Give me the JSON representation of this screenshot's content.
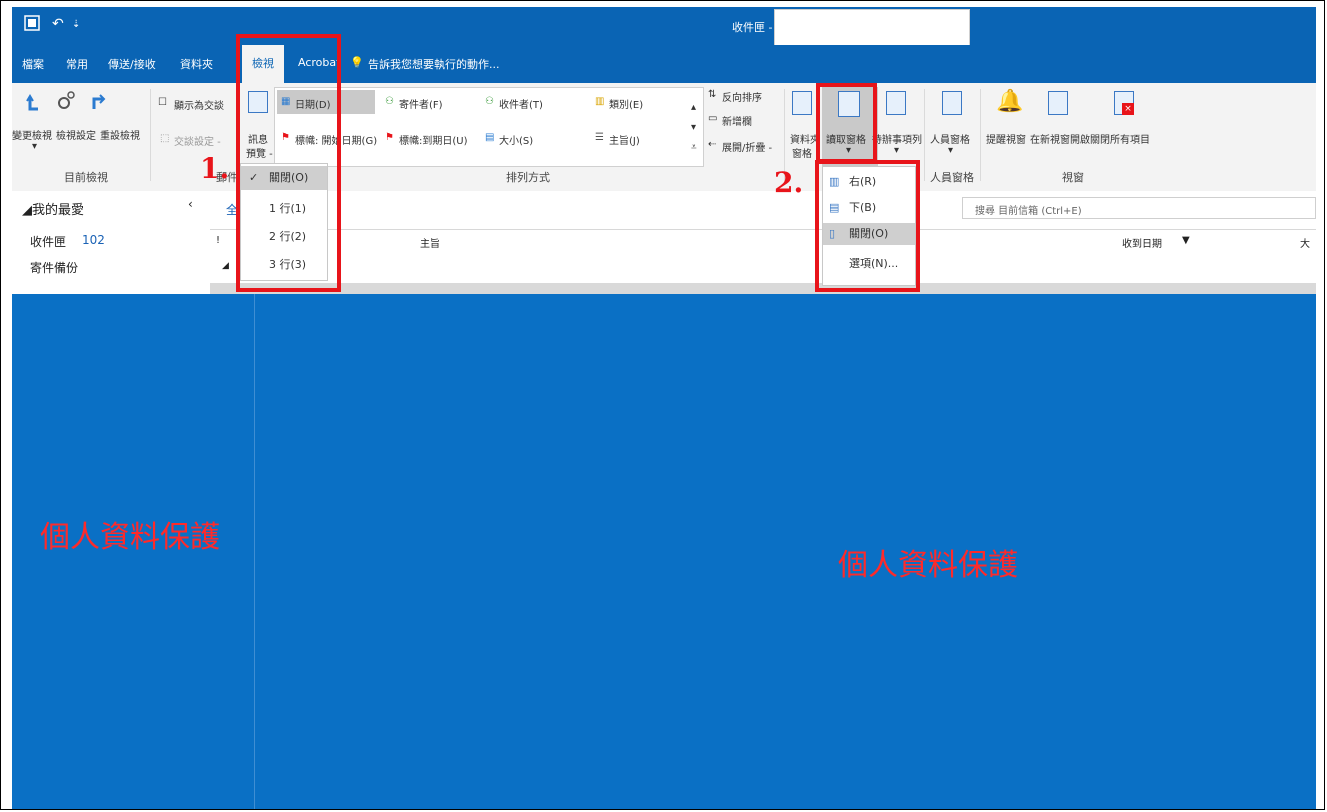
{
  "titlebar": {
    "title": "收件匣 -",
    "quick_undo": "↶",
    "quick_more": "⇣"
  },
  "tabs": [
    {
      "label": "檔案"
    },
    {
      "label": "常用"
    },
    {
      "label": "傳送/接收"
    },
    {
      "label": "資料夾"
    },
    {
      "label": "檢視",
      "active": true
    },
    {
      "label": "Acrobat"
    },
    {
      "label": "告訴我您想要執行的動作..."
    }
  ],
  "ribbon": {
    "current_view": {
      "change_view": "變更檢視",
      "view_settings": "檢視設定",
      "reset_view": "重設檢視",
      "group": "目前檢視"
    },
    "messages": {
      "show_conversations": "顯示為交談",
      "conversation_settings": "交談設定 -",
      "group": "郵件"
    },
    "preview": {
      "label_line1": "訊息",
      "label_line2": "預覽 -"
    },
    "arrangement": {
      "date": "日期(D)",
      "from": "寄件者(F)",
      "to": "收件者(T)",
      "categories": "類別(E)",
      "flag_start": "標幟: 開始日期(G)",
      "flag_due": "標幟:到期日(U)",
      "size": "大小(S)",
      "subject": "主旨(J)",
      "reverse_sort": "反向排序",
      "add_columns": "新增欄",
      "expand_collapse": "展開/折疊 -",
      "group": "排列方式"
    },
    "layout": {
      "folder_pane": "資料夾",
      "folder_pane2": "窗格",
      "reading_pane": "讀取窗格",
      "todo_bar": "待辦事項列",
      "people_pane": "人員窗格",
      "people_group": "人員窗格",
      "reminders": "提醒視窗",
      "open_new_window": "在新視窗開啟",
      "close_all": "關閉所有項目",
      "window_group": "視窗"
    }
  },
  "preview_menu": {
    "items": [
      {
        "label": "關閉(O)",
        "checked": true
      },
      {
        "label": "1 行(1)"
      },
      {
        "label": "2 行(2)"
      },
      {
        "label": "3 行(3)"
      }
    ]
  },
  "reading_menu": {
    "items": [
      {
        "label": "右(R)"
      },
      {
        "label": "下(B)"
      },
      {
        "label": "關閉(O)",
        "selected": true
      },
      {
        "label": "選項(N)..."
      }
    ]
  },
  "steps": {
    "one": "1.",
    "two": "2."
  },
  "navpane": {
    "favorites": "◢我的最愛",
    "inbox": "收件匣",
    "inbox_count": "102",
    "sent": "寄件備份"
  },
  "list": {
    "all_tab": "全",
    "col_flag": "!",
    "col_subject": "主旨",
    "col_received": "收到日期",
    "col_size": "大",
    "search_placeholder": "搜尋 目前信箱 (Ctrl+E)",
    "group_arrow": "◢"
  },
  "overlay": {
    "privacy_left": "個人資料保護",
    "privacy_right": "個人資料保護"
  },
  "colors": {
    "brand": "#0a64b4",
    "mask": "#0a70c5",
    "annotation": "#e8141a",
    "privacy_text": "#ff2a2a"
  }
}
